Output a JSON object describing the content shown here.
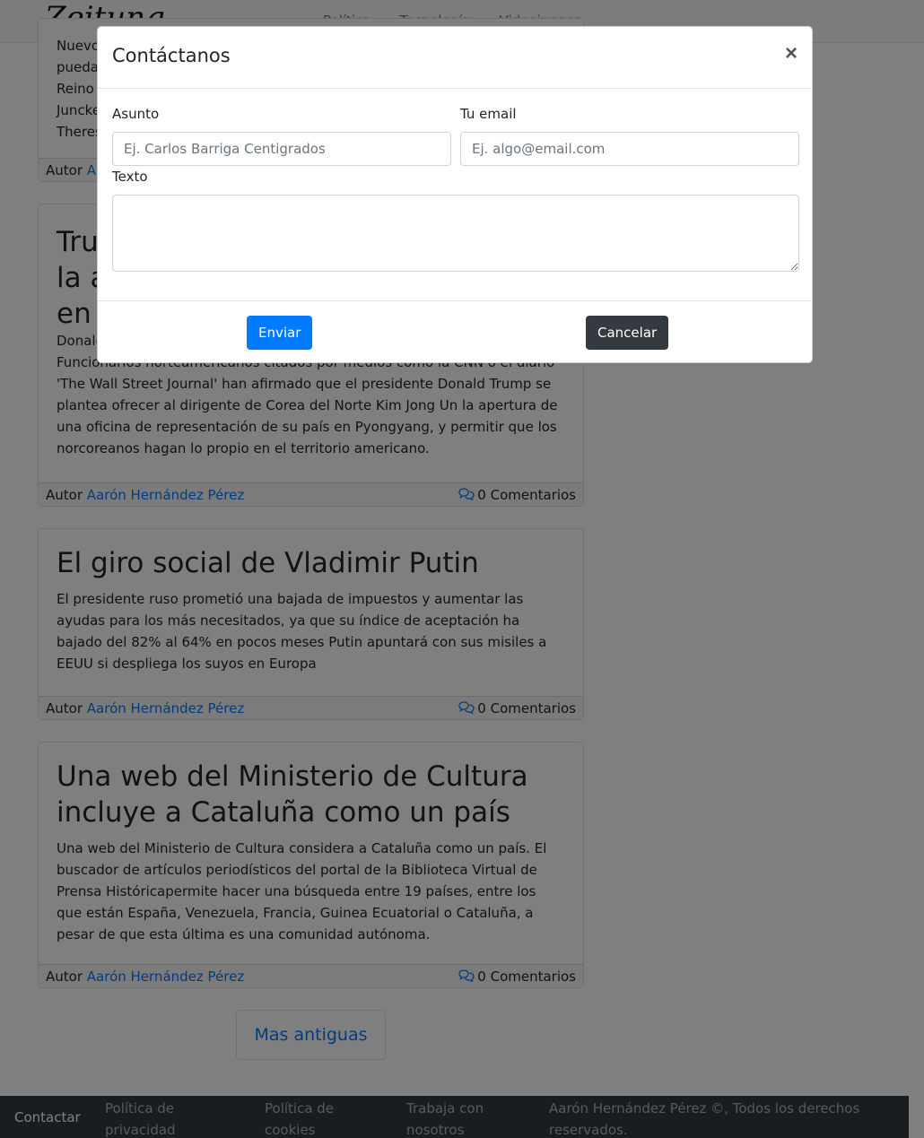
{
  "navbar": {
    "brand": "Zeitung",
    "links": [
      "Política",
      "Tecnología",
      "Videojuegos"
    ]
  },
  "article0": {
    "partial_lines": [
      "Nuevo",
      "pueda",
      "Reino",
      "Juncke",
      "Theres"
    ],
    "author_label": "Autor",
    "author_partial": "Aa"
  },
  "articles": [
    {
      "title_partial": [
        "Tru",
        "la a",
        "en"
      ],
      "text_first": "Donald",
      "text": "Funcionarios norteamericanos citados por medios como la CNN o el diario 'The Wall Street Journal' han afirmado que el presidente Donald Trump se plantea ofrecer al dirigente de Corea del Norte Kim Jong Un la apertura de una oficina de representación de su país en Pyongyang, y permitir que los norcoreanos hagan lo propio en el territorio americano.",
      "author_label": "Autor",
      "author": "Aarón Hernández Pérez",
      "comments": "0 Comentarios"
    },
    {
      "title": "El giro social de Vladimir Putin",
      "text": "El presidente ruso prometió una bajada de impuestos y aumentar las ayudas para los más necesitados, ya que su índice de aceptación ha bajado del 82% al 64% en pocos meses Putin apuntará con sus misiles a EEUU si despliega los suyos en Europa",
      "author_label": "Autor",
      "author": "Aarón Hernández Pérez",
      "comments": "0 Comentarios"
    },
    {
      "title": "Una web del Ministerio de Cultura incluye a Cataluña como un país",
      "text": "Una web del Ministerio de Cultura considera a Cataluña como un país. El buscador de artículos periodísticos del portal de la Biblioteca Virtual de Prensa Históricapermite hacer una búsqueda entre 19 países, entre los que están España, Venezuela, Francia, Guinea Ecuatorial o Cataluña, a pesar de que esta última es una comunidad autónoma.",
      "author_label": "Autor",
      "author": "Aarón Hernández Pérez",
      "comments": "0 Comentarios"
    }
  ],
  "more_button": "Mas antiguas",
  "footer": {
    "contact": "Contactar",
    "privacy": [
      "Política de",
      "privacidad"
    ],
    "cookies": [
      "Política de",
      "cookies"
    ],
    "work": [
      "Trabaja con",
      "nosotros"
    ],
    "copyright": [
      "Aarón Hernández Pérez ©, Todos los derechos",
      "reservados."
    ]
  },
  "modal": {
    "title": "Contáctanos",
    "close": "×",
    "subject_label": "Asunto",
    "subject_placeholder": "Ej. Carlos Barriga Centigrados",
    "email_label": "Tu email",
    "email_placeholder": "Ej. algo@email.com",
    "text_label": "Texto",
    "submit": "Enviar",
    "cancel": "Cancelar"
  },
  "colors": {
    "primary": "#007bff",
    "dark": "#343a40"
  }
}
